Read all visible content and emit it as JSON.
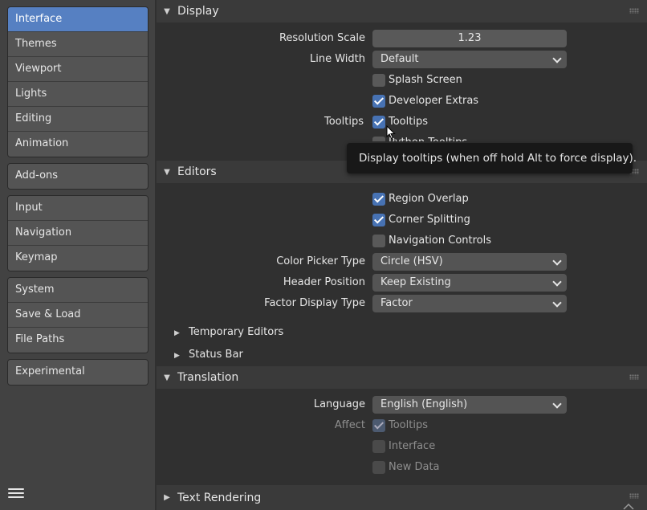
{
  "sidebar": {
    "groups": [
      [
        "Interface",
        "Themes",
        "Viewport",
        "Lights",
        "Editing",
        "Animation"
      ],
      [
        "Add-ons"
      ],
      [
        "Input",
        "Navigation",
        "Keymap"
      ],
      [
        "System",
        "Save & Load",
        "File Paths"
      ],
      [
        "Experimental"
      ]
    ],
    "active": "Interface",
    "menu_icon": "hamburger-icon"
  },
  "display": {
    "title": "Display",
    "resolution_label": "Resolution Scale",
    "resolution_value": "1.23",
    "line_width_label": "Line Width",
    "line_width_value": "Default",
    "splash_label": "Splash Screen",
    "splash_checked": false,
    "dev_extras_label": "Developer Extras",
    "dev_extras_checked": true,
    "tooltips_row_label": "Tooltips",
    "tooltips_label": "Tooltips",
    "tooltips_checked": true,
    "python_tooltips_label": "Python Tooltips"
  },
  "tooltip": {
    "text": "Display tooltips (when off hold Alt to force display)."
  },
  "editors": {
    "title": "Editors",
    "region_overlap_label": "Region Overlap",
    "corner_splitting_label": "Corner Splitting",
    "nav_controls_label": "Navigation Controls",
    "color_picker_label": "Color Picker Type",
    "color_picker_value": "Circle (HSV)",
    "header_position_label": "Header Position",
    "header_position_value": "Keep Existing",
    "factor_display_label": "Factor Display Type",
    "factor_display_value": "Factor",
    "temporary_editors": "Temporary Editors",
    "status_bar": "Status Bar"
  },
  "translation": {
    "title": "Translation",
    "language_label": "Language",
    "language_value": "English (English)",
    "affect_label": "Affect",
    "tooltips_label": "Tooltips",
    "interface_label": "Interface",
    "new_data_label": "New Data"
  },
  "text_rendering": {
    "title": "Text Rendering"
  },
  "colors": {
    "accent": "#5680c2",
    "checkbox_on": "#4772b3",
    "panel_bg": "#303030",
    "sidebar_bg": "#424242"
  }
}
